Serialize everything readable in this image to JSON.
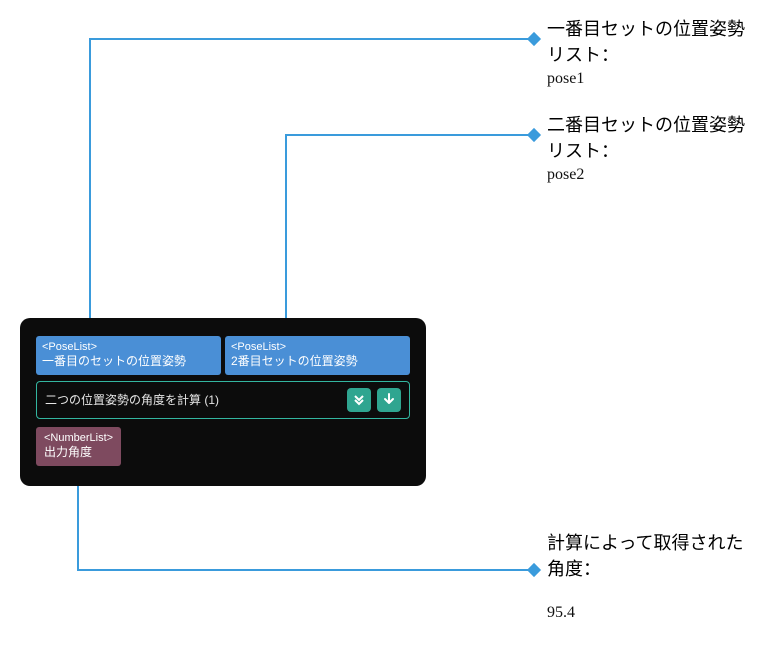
{
  "connector_color": "#3a9bdc",
  "node": {
    "inputs": [
      {
        "type": "<PoseList>",
        "label": "一番目のセットの位置姿勢"
      },
      {
        "type": "<PoseList>",
        "label": "2番目セットの位置姿勢"
      }
    ],
    "title": "二つの位置姿勢の角度を計算 (1)",
    "buttons": {
      "expand": "expand-down-icon",
      "run": "arrow-down-icon"
    },
    "output": {
      "type": "<NumberList>",
      "label": "出力角度"
    }
  },
  "callouts": {
    "input1": {
      "title": "一番目セットの位置姿勢リスト：",
      "value": "pose1"
    },
    "input2": {
      "title": "二番目セットの位置姿勢リスト：",
      "value": "pose2"
    },
    "output": {
      "title": "計算によって取得された角度：",
      "value": "95.4"
    }
  }
}
